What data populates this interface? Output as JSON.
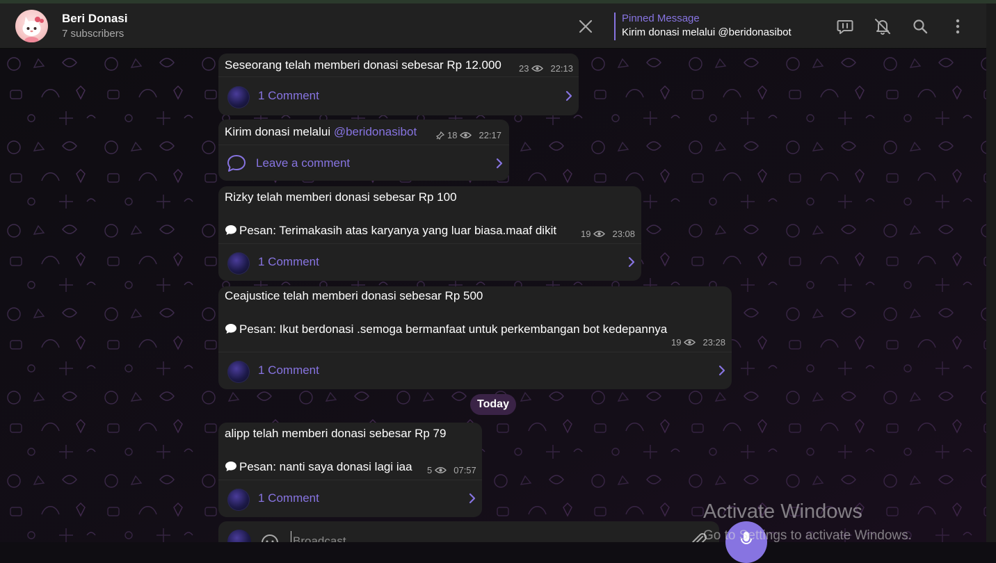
{
  "header": {
    "title": "Beri Donasi",
    "subtitle": "7 subscribers",
    "pinned_label": "Pinned Message",
    "pinned_text": "Kirim donasi melalui @beridonasibot"
  },
  "messages": [
    {
      "text": "Seseorang telah memberi donasi sebesar Rp 12.000",
      "views": "23",
      "time": "22:13",
      "comment_label": "1 Comment"
    },
    {
      "text_prefix": "Kirim donasi melalui ",
      "text_link": "@beridonasibot",
      "views": "18",
      "time": "22:17",
      "comment_label": "Leave a comment"
    },
    {
      "text": "Rizky telah memberi donasi sebesar Rp 100",
      "note": "Pesan: Terimakasih atas karyanya yang luar biasa.maaf dikit",
      "views": "19",
      "time": "23:08",
      "comment_label": "1 Comment"
    },
    {
      "text": "Ceajustice telah memberi donasi sebesar Rp 500",
      "note": "Pesan: Ikut berdonasi .semoga bermanfaat untuk perkembangan bot kedepannya",
      "views": "19",
      "time": "23:28",
      "comment_label": "1 Comment"
    },
    {
      "text": "alipp telah memberi donasi sebesar Rp 79",
      "note": "Pesan: nanti saya donasi lagi iaa",
      "views": "5",
      "time": "07:57",
      "comment_label": "1 Comment"
    }
  ],
  "date_divider": "Today",
  "composer": {
    "placeholder": "Broadcast"
  },
  "watermark": {
    "line1": "Activate Windows",
    "line2": "Go to Settings to activate Windows."
  },
  "colors": {
    "accent": "#8774e1",
    "bubble": "#212121",
    "background": "#0f0d12"
  },
  "icons": [
    "close-icon",
    "discussion-icon",
    "mute-bell-icon",
    "search-icon",
    "more-vertical-icon",
    "eye-icon",
    "pin-icon",
    "comment-icon",
    "chevron-right-icon",
    "speech-balloon-icon",
    "emoji-icon",
    "attach-icon"
  ]
}
